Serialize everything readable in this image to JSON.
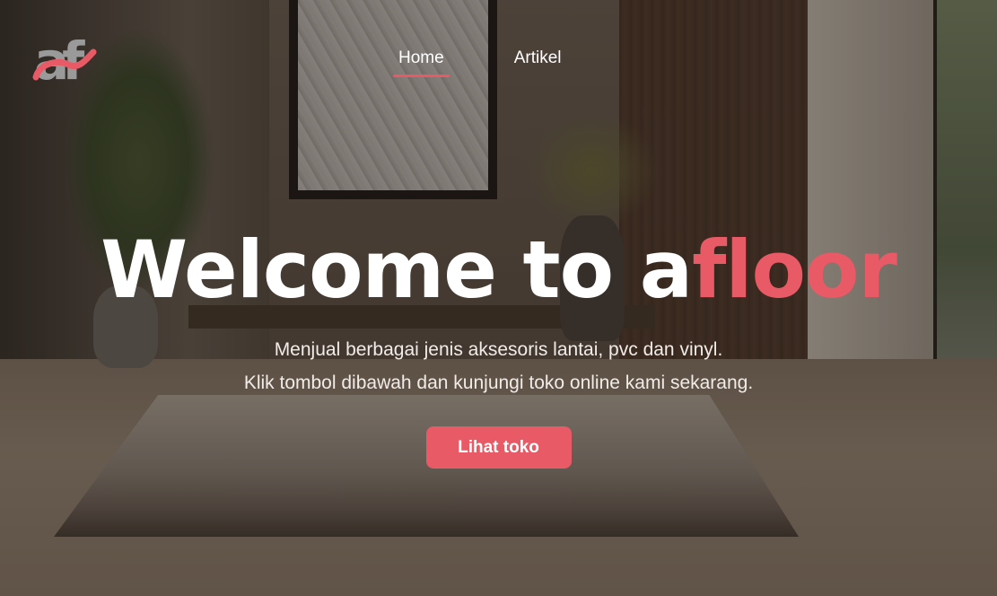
{
  "brand": {
    "logo_text": "af",
    "accent_color": "#e85a65",
    "logo_gray": "#9a9a9a"
  },
  "nav": {
    "items": [
      {
        "label": "Home",
        "active": true
      },
      {
        "label": "Artikel",
        "active": false
      }
    ]
  },
  "hero": {
    "title_prefix": "Welcome to a",
    "title_accent": "floor",
    "subtitle_line1": "Menjual berbagai jenis aksesoris lantai, pvc dan vinyl.",
    "subtitle_line2": "Klik tombol dibawah dan kunjungi toko online kami sekarang.",
    "cta_label": "Lihat toko"
  }
}
